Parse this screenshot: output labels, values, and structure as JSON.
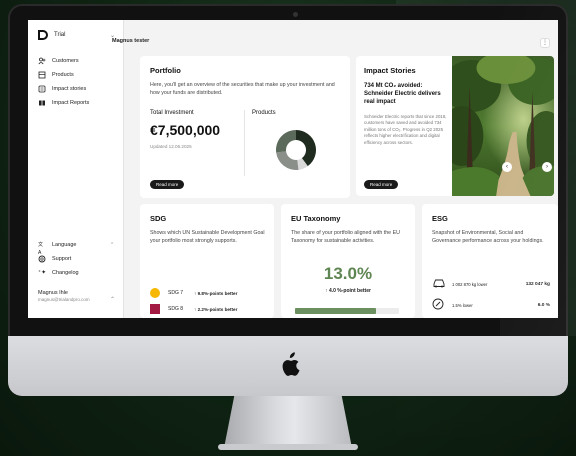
{
  "sidebar": {
    "brand": "Trial",
    "nav": [
      {
        "label": "Customers",
        "icon": "customers-icon"
      },
      {
        "label": "Products",
        "icon": "products-icon"
      },
      {
        "label": "Impact stories",
        "icon": "impact-stories-icon"
      },
      {
        "label": "Impact Reports",
        "icon": "impact-reports-icon"
      }
    ],
    "bottom": [
      {
        "label": "Language",
        "icon": "language-icon"
      },
      {
        "label": "Support",
        "icon": "support-icon"
      },
      {
        "label": "Changelog",
        "icon": "changelog-icon"
      }
    ],
    "user": {
      "name": "Magnus Ihle",
      "email": "magnus@trialandpro.com"
    }
  },
  "header": {
    "user": "Magnus tester"
  },
  "portfolio": {
    "title": "Portfolio",
    "description": "Here, you'll get an overview of the securities that make up your investment and how your funds are distributed.",
    "total_label": "Total Investment",
    "total_value": "€7,500,000",
    "updated": "Updated 12.06.2025",
    "products_label": "Products",
    "read_more": "Read more",
    "donut": [
      {
        "value": 40,
        "color": "#1e2b1e"
      },
      {
        "value": 8,
        "color": "#d9d9d9"
      },
      {
        "value": 25,
        "color": "#8a8f8a"
      },
      {
        "value": 27,
        "color": "#5b6a5b"
      }
    ]
  },
  "impact": {
    "title": "Impact Stories",
    "headline": "734 Mt CO₂ avoided: Schneider Electric delivers real impact",
    "body": "Schneider Electric reports that since 2018, customers have saved and avoided 734 million tons of CO₂. Progress in Q2 2025 reflects higher electrification and digital efficiency across sectors.",
    "read_more": "Read more"
  },
  "sdg": {
    "title": "SDG",
    "description": "Shows which UN Sustainable Development Goal your portfolio most strongly supports.",
    "rows": [
      {
        "goal": "SDG 7",
        "change": "↑ 9.8%-points better",
        "color": "#f5b700"
      },
      {
        "goal": "SDG 8",
        "change": "↑ 2.2%-points better",
        "color": "#a21942"
      }
    ]
  },
  "eutax": {
    "title": "EU Taxonomy",
    "description": "The share of your portfolio aligned with the EU Taxonomy for sustainable activities.",
    "value": "13.0%",
    "change": "↑ 4.0 %-point better",
    "bar_fill": 0.78,
    "color": "#6b8f5e"
  },
  "esg": {
    "title": "ESG",
    "description": "Snapshot of Environmental, Social and Governance performance across your holdings.",
    "rows": [
      {
        "icon": "car-icon",
        "label": "1 002 870 kg lower",
        "value": "132 047 kg"
      },
      {
        "icon": "gauge-icon",
        "label": "1.5% lower",
        "value": "6.0 %"
      }
    ]
  }
}
